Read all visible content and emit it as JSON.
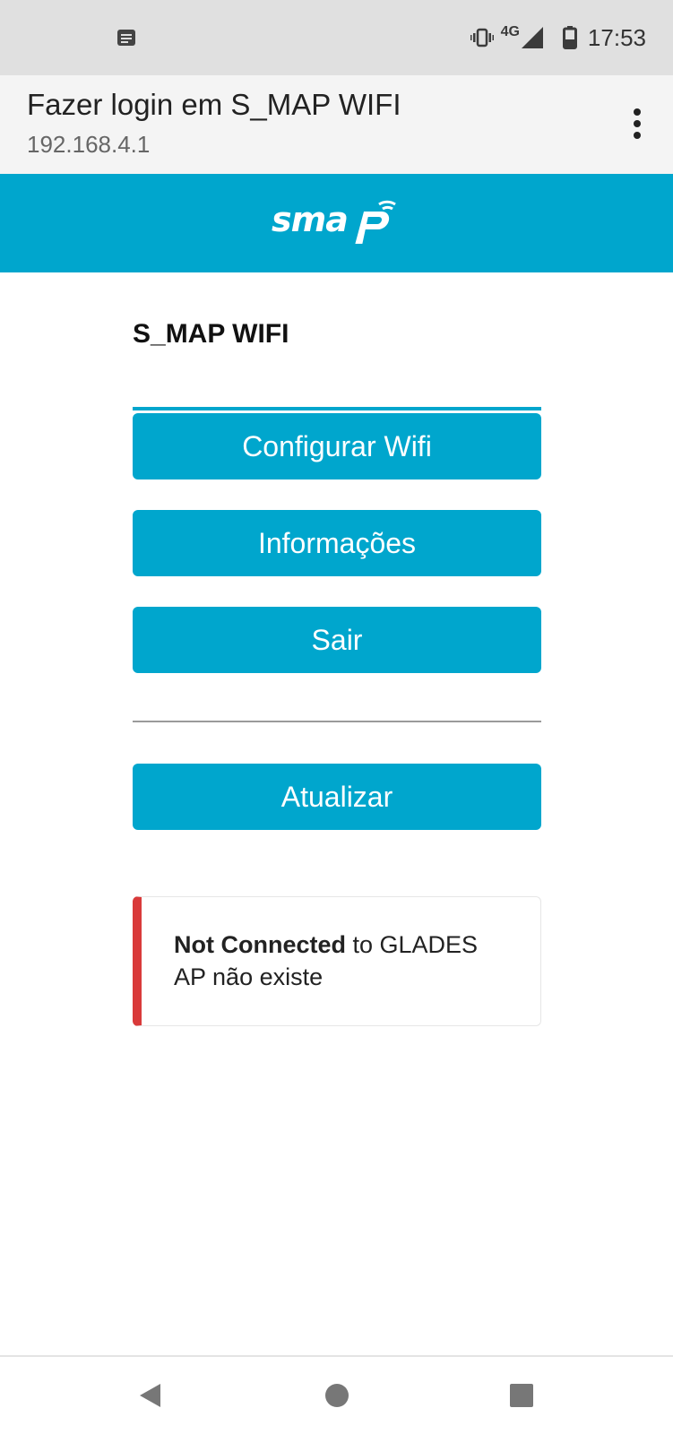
{
  "status_bar": {
    "network": "4G",
    "time": "17:53",
    "icons": [
      "notification-icon",
      "vibrate-icon",
      "signal-icon",
      "battery-icon"
    ]
  },
  "browser": {
    "title": "Fazer login em S_MAP WIFI",
    "url": "192.168.4.1",
    "menu_icon": "more-vert-icon"
  },
  "brand": {
    "logo_text": "smap",
    "color": "#00a6cd"
  },
  "main": {
    "heading": "S_MAP WIFI",
    "buttons": {
      "configure": "Configurar Wifi",
      "info": "Informações",
      "exit": "Sair",
      "refresh": "Atualizar"
    }
  },
  "status_message": {
    "strong": "Not Connected",
    "rest": " to GLADES",
    "detail": "AP não existe",
    "accent_color": "#d93a3a"
  },
  "nav": {
    "icons": [
      "back-icon",
      "home-icon",
      "recents-icon"
    ]
  }
}
